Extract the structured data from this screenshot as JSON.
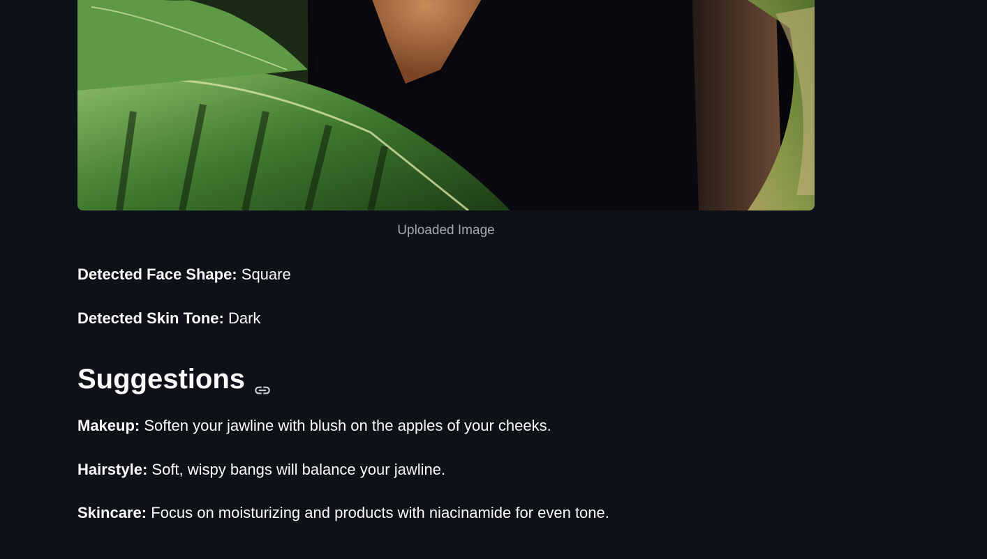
{
  "image": {
    "caption": "Uploaded Image"
  },
  "results": {
    "face_shape_label": "Detected Face Shape:",
    "face_shape_value": "Square",
    "skin_tone_label": "Detected Skin Tone:",
    "skin_tone_value": "Dark"
  },
  "suggestions": {
    "heading": "Suggestions",
    "anchor_icon": "link-icon",
    "makeup_label": "Makeup:",
    "makeup_text": "Soften your jawline with blush on the apples of your cheeks.",
    "hairstyle_label": "Hairstyle:",
    "hairstyle_text": "Soft, wispy bangs will balance your jawline.",
    "skincare_label": "Skincare:",
    "skincare_text": "Focus on moisturizing and products with niacinamide for even tone."
  },
  "colors": {
    "background": "#0e1117",
    "text": "#fafafa",
    "caption": "#a3a8b4"
  }
}
